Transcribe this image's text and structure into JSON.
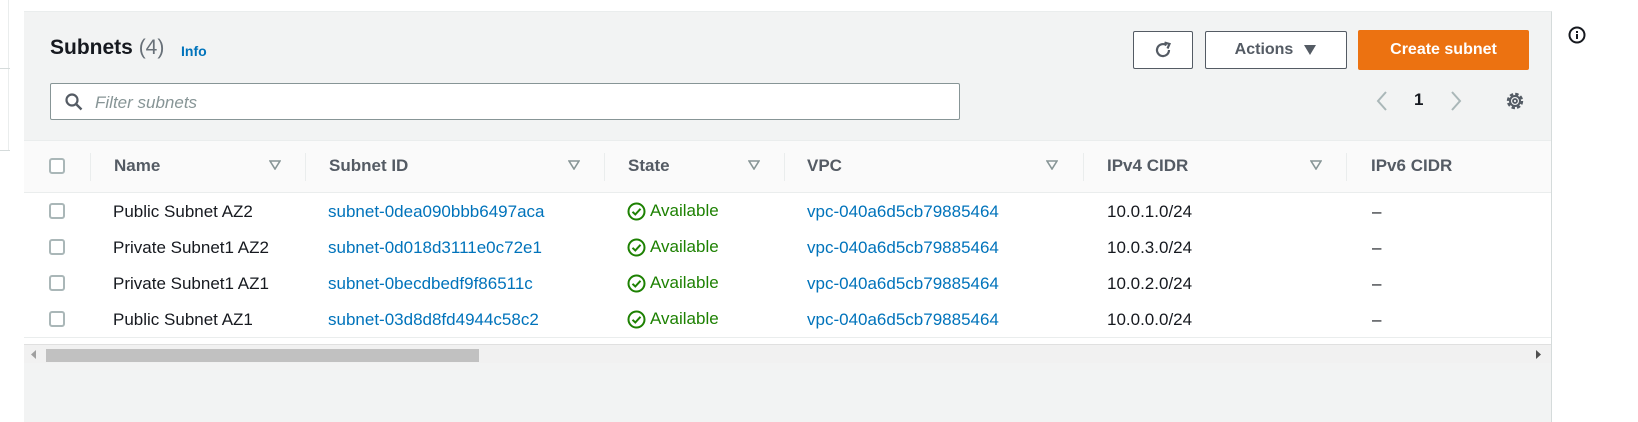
{
  "header": {
    "title": "Subnets",
    "count": "(4)",
    "info_link": "Info"
  },
  "toolbar": {
    "refresh_icon": "refresh-icon",
    "actions_label": "Actions",
    "create_label": "Create subnet"
  },
  "filter": {
    "placeholder": "Filter subnets",
    "value": ""
  },
  "pagination": {
    "current_page": "1"
  },
  "table": {
    "columns": [
      "Name",
      "Subnet ID",
      "State",
      "VPC",
      "IPv4 CIDR",
      "IPv6 CIDR"
    ],
    "rows": [
      {
        "name": "Public Subnet AZ2",
        "subnet_id": "subnet-0dea090bbb6497aca",
        "state": "Available",
        "vpc": "vpc-040a6d5cb79885464",
        "ipv4": "10.0.1.0/24",
        "ipv6": "–"
      },
      {
        "name": "Private Subnet1 AZ2",
        "subnet_id": "subnet-0d018d3111e0c72e1",
        "state": "Available",
        "vpc": "vpc-040a6d5cb79885464",
        "ipv4": "10.0.3.0/24",
        "ipv6": "–"
      },
      {
        "name": "Private Subnet1 AZ1",
        "subnet_id": "subnet-0becdbedf9f86511c",
        "state": "Available",
        "vpc": "vpc-040a6d5cb79885464",
        "ipv4": "10.0.2.0/24",
        "ipv6": "–"
      },
      {
        "name": "Public Subnet AZ1",
        "subnet_id": "subnet-03d8d8fd4944c58c2",
        "state": "Available",
        "vpc": "vpc-040a6d5cb79885464",
        "ipv4": "10.0.0.0/24",
        "ipv6": "–"
      }
    ]
  },
  "colors": {
    "primary_button": "#ec7211",
    "link": "#0073bb",
    "status_success": "#1d8102",
    "panel_background": "#f2f3f3"
  }
}
